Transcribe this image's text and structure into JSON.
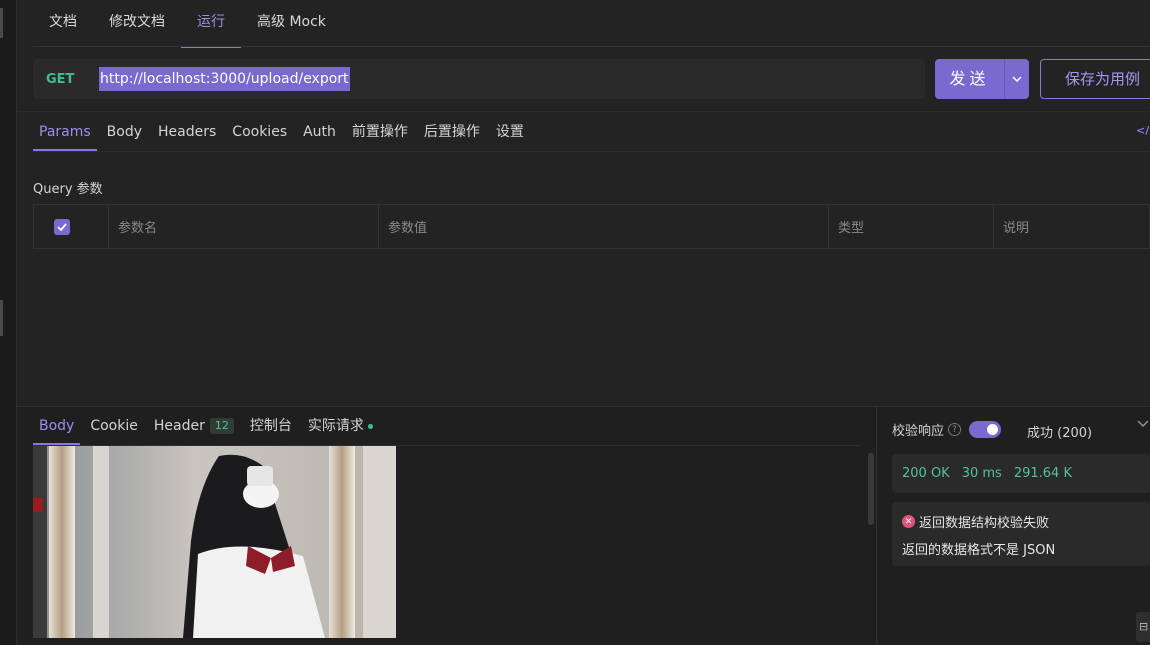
{
  "top_tabs": [
    {
      "label": "文档"
    },
    {
      "label": "修改文档"
    },
    {
      "label": "运行"
    },
    {
      "label": "高级 Mock"
    }
  ],
  "request": {
    "method": "GET",
    "url": "http://localhost:3000/upload/export",
    "send_label": "发送",
    "save_label": "保存为用例"
  },
  "request_tabs": [
    {
      "label": "Params"
    },
    {
      "label": "Body"
    },
    {
      "label": "Headers"
    },
    {
      "label": "Cookies"
    },
    {
      "label": "Auth"
    },
    {
      "label": "前置操作"
    },
    {
      "label": "后置操作"
    },
    {
      "label": "设置"
    }
  ],
  "query": {
    "title": "Query 参数",
    "columns": {
      "name": "参数名",
      "value": "参数值",
      "type": "类型",
      "desc": "说明"
    }
  },
  "response_tabs": {
    "body": "Body",
    "cookie": "Cookie",
    "header": "Header",
    "header_count": "12",
    "console": "控制台",
    "actual": "实际请求"
  },
  "validation": {
    "label": "校验响应",
    "help": "?",
    "status": "成功 (200)",
    "status_code": "200 OK",
    "time": "30 ms",
    "size": "291.64 K",
    "error_title": "返回数据结构校验失败",
    "error_detail": "返回的数据格式不是 JSON"
  },
  "icons": {
    "code": "code-icon",
    "dropdown": "chevron-down-icon",
    "error": "close-circle-icon"
  },
  "colors": {
    "accent": "#7a69cf",
    "success": "#3fbf8f",
    "error": "#e0547a"
  }
}
